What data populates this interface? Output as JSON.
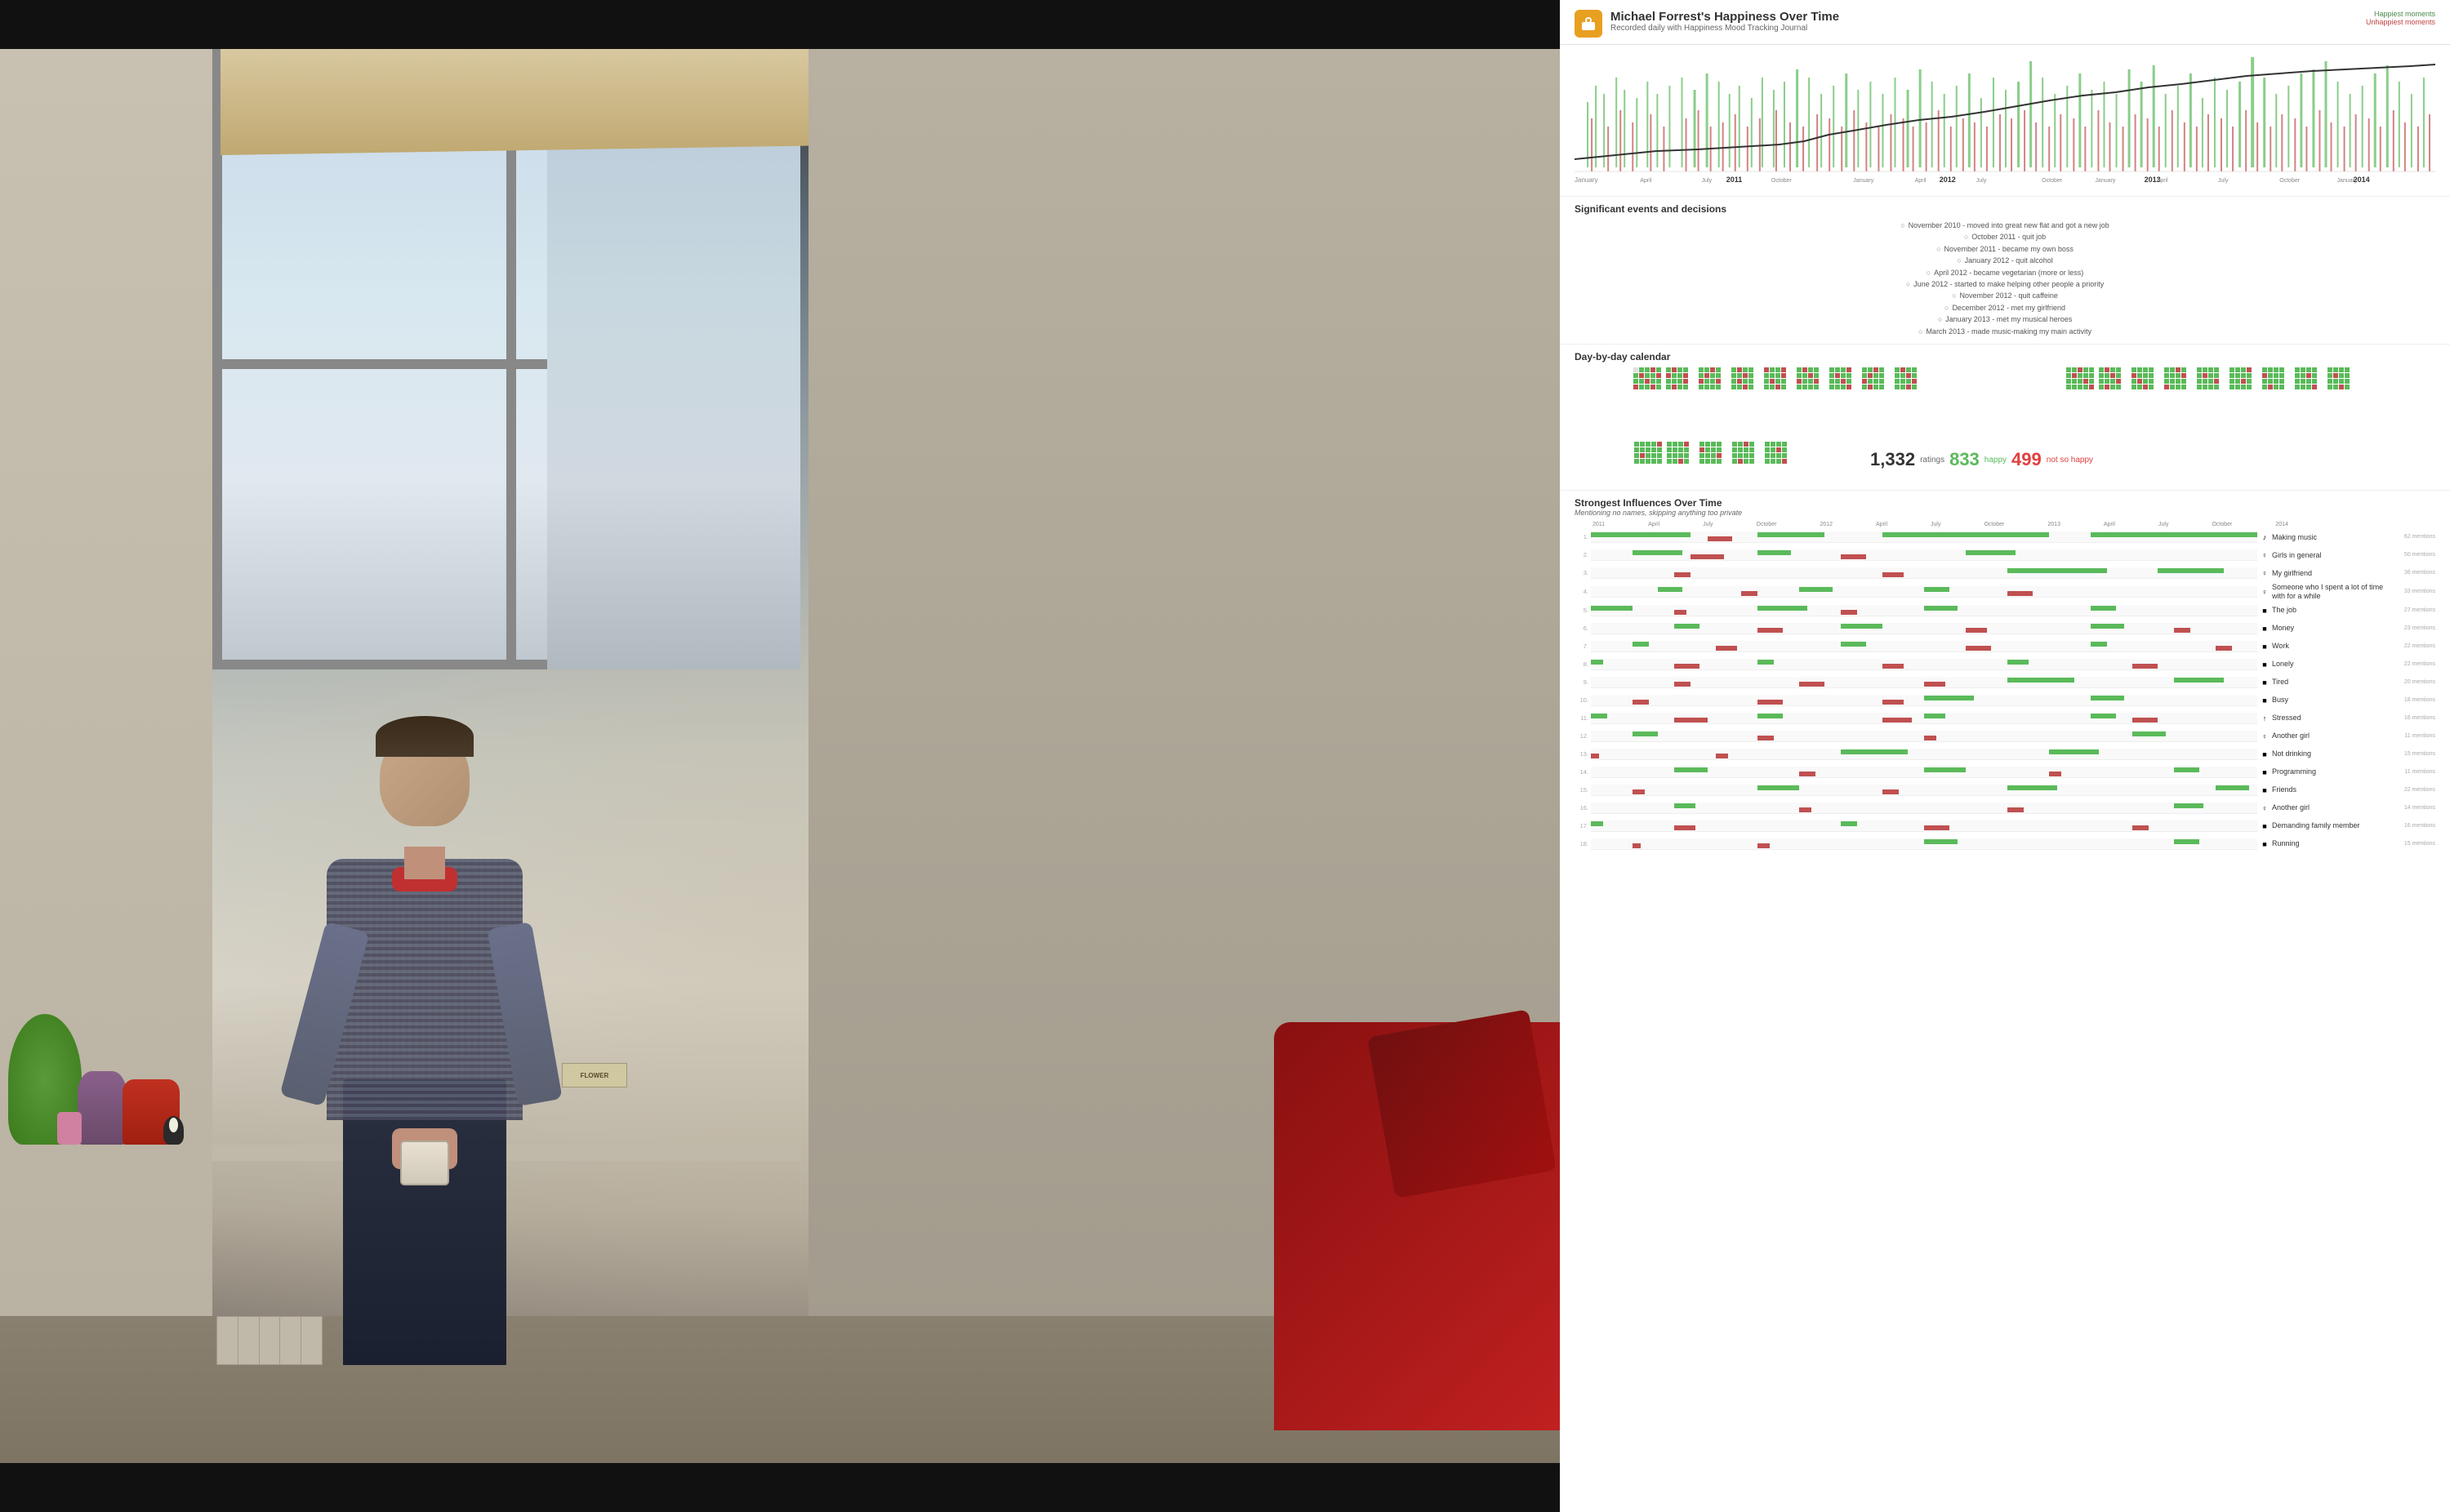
{
  "header": {
    "title": "Michael Forrest's Happiness Over Time",
    "subtitle": "Recorded daily with Happiness Mood Tracking Journal",
    "happiest_label": "Happiest moments",
    "unhappiest_label": "Unhappiest moments",
    "icon_label": "app-icon"
  },
  "years": [
    "2011",
    "2012",
    "2013",
    "2014"
  ],
  "axis_labels": [
    "January",
    "April",
    "July",
    "October",
    "January",
    "April",
    "July",
    "October",
    "January",
    "April",
    "July",
    "October",
    "January"
  ],
  "events_section": {
    "title": "Significant events and decisions",
    "events": [
      "November 2010 - moved into great new flat and got a new job",
      "October 2011 - quit job",
      "November 2011 - became my own boss",
      "January 2012 - quit alcohol",
      "April 2012 - became vegetarian (more or less)",
      "June 2012 - started to make helping other people a priority",
      "November 2012 - quit caffeine",
      "December 2012 - met my girlfriend",
      "January 2013 - met my musical heroes",
      "March 2013 - made music-making my main activity"
    ]
  },
  "calendar_section": {
    "title": "Day-by-day calendar",
    "stats": {
      "total": "1,332",
      "total_label": "ratings",
      "happy": "833",
      "happy_label": "happy",
      "unhappy": "499",
      "unhappy_label": "not so happy"
    }
  },
  "influences_section": {
    "title": "Strongest Influences Over Time",
    "subtitle": "Mentioning no names, skipping anything too private",
    "timeline_labels": [
      "2011",
      "April",
      "July",
      "October",
      "2012",
      "April",
      "July",
      "October",
      "2013",
      "April",
      "July",
      "October",
      "2014"
    ],
    "influences": [
      {
        "rank": "1",
        "name": "Making music",
        "count": "62 mentions",
        "icon": "♪",
        "icon_type": "music",
        "color_rank": "green"
      },
      {
        "rank": "2",
        "name": "Girls in general",
        "count": "50 mentions",
        "icon": "♀",
        "icon_type": "female",
        "color_rank": "pink"
      },
      {
        "rank": "3",
        "name": "My girlfriend",
        "count": "36 mentions",
        "icon": "♀",
        "icon_type": "female",
        "color_rank": "pink"
      },
      {
        "rank": "4",
        "name": "Someone who I spent a lot of time with for a while",
        "count": "33 mentions",
        "icon": "♀",
        "icon_type": "female",
        "color_rank": "pink"
      },
      {
        "rank": "5",
        "name": "The job",
        "count": "27 mentions",
        "icon": "■",
        "icon_type": "work",
        "color_rank": "gray"
      },
      {
        "rank": "6",
        "name": "Money",
        "count": "23 mentions",
        "icon": "■",
        "icon_type": "money",
        "color_rank": "gray"
      },
      {
        "rank": "7",
        "name": "Work",
        "count": "22 mentions",
        "icon": "■",
        "icon_type": "work",
        "color_rank": "gray"
      },
      {
        "rank": "8",
        "name": "Lonely",
        "count": "22 mentions",
        "icon": "■",
        "icon_type": "misc",
        "color_rank": "gray"
      },
      {
        "rank": "9",
        "name": "Tired",
        "count": "20 mentions",
        "icon": "■",
        "icon_type": "misc",
        "color_rank": "gray"
      },
      {
        "rank": "10",
        "name": "Busy",
        "count": "18 mentions",
        "icon": "■",
        "icon_type": "misc",
        "color_rank": "gray"
      },
      {
        "rank": "11",
        "name": "Stressed",
        "count": "16 mentions",
        "icon": "↑",
        "icon_type": "stress",
        "color_rank": "red"
      },
      {
        "rank": "12",
        "name": "Another girl",
        "count": "11 mentions",
        "icon": "♀",
        "icon_type": "female",
        "color_rank": "pink"
      },
      {
        "rank": "13",
        "name": "Not drinking",
        "count": "15 mentions",
        "icon": "■",
        "icon_type": "misc",
        "color_rank": "gray"
      },
      {
        "rank": "14",
        "name": "Programming",
        "count": "11 mentions",
        "icon": "■",
        "icon_type": "misc",
        "color_rank": "gray"
      },
      {
        "rank": "15",
        "name": "Friends",
        "count": "22 mentions",
        "icon": "■",
        "icon_type": "misc",
        "color_rank": "gray"
      },
      {
        "rank": "16",
        "name": "Another girl",
        "count": "14 mentions",
        "icon": "♀",
        "icon_type": "female",
        "color_rank": "pink"
      },
      {
        "rank": "17",
        "name": "Demanding family member",
        "count": "16 mentions",
        "icon": "■",
        "icon_type": "misc",
        "color_rank": "gray"
      },
      {
        "rank": "18",
        "name": "Running",
        "count": "15 mentions",
        "icon": "♪",
        "icon_type": "activity",
        "color_rank": "green"
      }
    ]
  }
}
